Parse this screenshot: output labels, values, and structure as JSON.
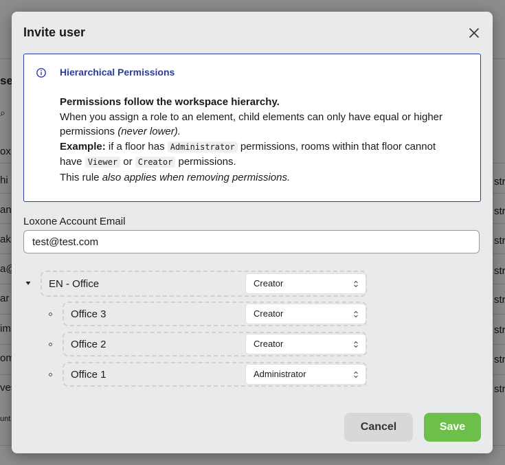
{
  "modal": {
    "title": "Invite user",
    "close_icon": "close-icon"
  },
  "info": {
    "icon": "info-icon",
    "title": "Hierarchical Permissions",
    "heading": "Permissions follow the workspace hierarchy.",
    "line1": "When you assign a role to an element, child elements can only have equal or higher",
    "line2_text": "permissions ",
    "line2_italic": "(never lower).",
    "ex_label": "Example:",
    "ex_text1": " if a floor has ",
    "ex_code1": "Administrator",
    "ex_text2": " permissions, rooms within that floor cannot",
    "ex2_text1": "have ",
    "ex2_code1": "Viewer",
    "ex2_text2": " or ",
    "ex2_code2": "Creator",
    "ex2_text3": " permissions.",
    "rule_text": "This rule ",
    "rule_italic": "also applies when removing permissions."
  },
  "email": {
    "label": "Loxone Account Email",
    "value": "test@test.com"
  },
  "tree": {
    "root": {
      "label": "EN - Office",
      "role": "Creator"
    },
    "children": [
      {
        "label": "Office 3",
        "role": "Creator"
      },
      {
        "label": "Office 2",
        "role": "Creator"
      },
      {
        "label": "Office 1",
        "role": "Administrator"
      }
    ]
  },
  "buttons": {
    "cancel": "Cancel",
    "save": "Save"
  },
  "colors": {
    "accent_blue": "#2a3aa0",
    "save_green": "#6cc04a",
    "cancel_gray": "#d7d8da"
  },
  "background_fragments": {
    "left": [
      "se",
      "ox",
      "hi",
      "an",
      "ak",
      "a@",
      "ar",
      "im",
      "om",
      "ves",
      "unt"
    ],
    "right": [
      "str",
      "str",
      "str",
      "str",
      "str",
      "str",
      "str",
      "str"
    ]
  }
}
